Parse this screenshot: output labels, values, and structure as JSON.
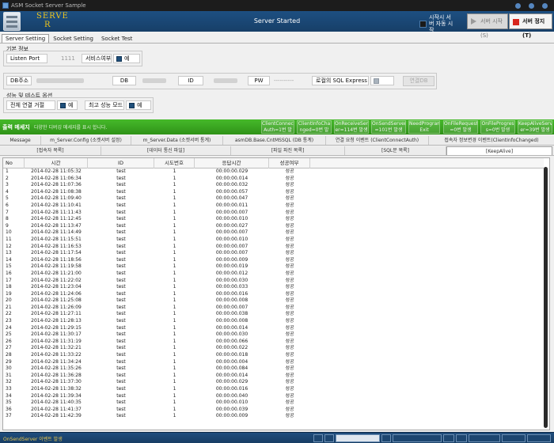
{
  "window": {
    "title": "ASM Socket Server Sample"
  },
  "header": {
    "logo_text_1": "SERVE",
    "logo_text_2": "R",
    "status": "Server Started",
    "auto_start_label": "시작시 서버 자동 시작",
    "start_button": "서버 시작(S)",
    "stop_button": "서버 정지(T)"
  },
  "tabs": [
    "Server Setting",
    "Socket Setting",
    "Socket Test"
  ],
  "basic_info": {
    "title": "기본 정보",
    "listen_port_label": "Listen Port",
    "listen_port_value": "1111",
    "service_label": "서비스여부",
    "service_value": "예"
  },
  "db": {
    "addr_label": "DB주소",
    "db_label": "DB",
    "id_label": "ID",
    "pw_label": "PW",
    "pw_value": "----------",
    "local_sql_label": "로컬의 SQL Express",
    "connect_button": "연결DB"
  },
  "perf": {
    "title": "성능 및 테스트 옵션",
    "reject_label": "전체 연결 거절",
    "reject_value": "예",
    "max_perf_label": "최고 성능 모드",
    "max_perf_value": "예"
  },
  "messages": {
    "label": "출력 메세지",
    "hint": "다양한 디버깅 메세지를 표시 합니다.",
    "events": [
      {
        "line1": "ClientConnect",
        "line2": "Auth=1번 발생"
      },
      {
        "line1": "ClientInfoCha",
        "line2": "nged=0번 발생"
      },
      {
        "line1": "OnReceiveServ",
        "line2": "er=114번 발생"
      },
      {
        "line1": "OnSendServer",
        "line2": "=101번 발생"
      },
      {
        "line1": "NeedProgram",
        "line2": "Exit"
      },
      {
        "line1": "OnFileRequest",
        "line2": "=0번 발생"
      },
      {
        "line1": "OnFileProgres",
        "line2": "s=0번 발생"
      },
      {
        "line1": "KeepAliveServ",
        "line2": "er=39번 발생"
      }
    ]
  },
  "message_tabs_row1": [
    "Message",
    "m_Server.Config (소켓서버 설정)",
    "m_Server.Data (소켓서버 통계)",
    "asmDB.Base.CntMSSQL (DB 통계)",
    "연결 요청 이벤트 (ClientConnectAuth)",
    "접속자 정보변경 이벤트(ClientInfoChanged)"
  ],
  "message_tabs_row2": [
    "[접속자 목록]",
    "[데이터 통신 파일]",
    "[파일 파진 목록]",
    "[SQL문 목록]",
    "[KeepAlive]"
  ],
  "grid": {
    "columns": [
      "No",
      "시간",
      "ID",
      "시도번호",
      "응답시간",
      "성공여부"
    ],
    "rows": [
      [
        "1",
        "2014-02-28 11:05:32",
        "test",
        "1",
        "00:00:00.029",
        "성공"
      ],
      [
        "2",
        "2014-02-28 11:06:34",
        "test",
        "1",
        "00:00:00.014",
        "성공"
      ],
      [
        "3",
        "2014-02-28 11:07:36",
        "test",
        "1",
        "00:00:00.032",
        "성공"
      ],
      [
        "4",
        "2014-02-28 11:08:38",
        "test",
        "1",
        "00:00:00.057",
        "성공"
      ],
      [
        "5",
        "2014-02-28 11:09:40",
        "test",
        "1",
        "00:00:00.047",
        "성공"
      ],
      [
        "6",
        "2014-02-28 11:10:41",
        "test",
        "1",
        "00:00:00.011",
        "성공"
      ],
      [
        "7",
        "2014-02-28 11:11:43",
        "test",
        "1",
        "00:00:00.007",
        "성공"
      ],
      [
        "8",
        "2014-02-28 11:12:45",
        "test",
        "1",
        "00:00:00.010",
        "성공"
      ],
      [
        "9",
        "2014-02-28 11:13:47",
        "test",
        "1",
        "00:00:00.027",
        "성공"
      ],
      [
        "10",
        "2014-02-28 11:14:49",
        "test",
        "1",
        "00:00:00.007",
        "성공"
      ],
      [
        "11",
        "2014-02-28 11:15:51",
        "test",
        "1",
        "00:00:00.010",
        "성공"
      ],
      [
        "12",
        "2014-02-28 11:16:53",
        "test",
        "1",
        "00:00:00.007",
        "성공"
      ],
      [
        "13",
        "2014-02-28 11:17:54",
        "test",
        "1",
        "00:00:00.007",
        "성공"
      ],
      [
        "14",
        "2014-02-28 11:18:56",
        "test",
        "1",
        "00:00:00.009",
        "성공"
      ],
      [
        "15",
        "2014-02-28 11:19:58",
        "test",
        "1",
        "00:00:00.019",
        "성공"
      ],
      [
        "16",
        "2014-02-28 11:21:00",
        "test",
        "1",
        "00:00:00.012",
        "성공"
      ],
      [
        "17",
        "2014-02-28 11:22:02",
        "test",
        "1",
        "00:00:00.030",
        "성공"
      ],
      [
        "18",
        "2014-02-28 11:23:04",
        "test",
        "1",
        "00:00:00.033",
        "성공"
      ],
      [
        "19",
        "2014-02-28 11:24:06",
        "test",
        "1",
        "00:00:00.016",
        "성공"
      ],
      [
        "20",
        "2014-02-28 11:25:08",
        "test",
        "1",
        "00:00:00.008",
        "성공"
      ],
      [
        "21",
        "2014-02-28 11:26:09",
        "test",
        "1",
        "00:00:00.007",
        "성공"
      ],
      [
        "22",
        "2014-02-28 11:27:11",
        "test",
        "1",
        "00:00:00.038",
        "성공"
      ],
      [
        "23",
        "2014-02-28 11:28:13",
        "test",
        "1",
        "00:00:00.008",
        "성공"
      ],
      [
        "24",
        "2014-02-28 11:29:15",
        "test",
        "1",
        "00:00:00.014",
        "성공"
      ],
      [
        "25",
        "2014-02-28 11:30:17",
        "test",
        "1",
        "00:00:00.030",
        "성공"
      ],
      [
        "26",
        "2014-02-28 11:31:19",
        "test",
        "1",
        "00:00:00.066",
        "성공"
      ],
      [
        "27",
        "2014-02-28 11:32:21",
        "test",
        "1",
        "00:00:00.022",
        "성공"
      ],
      [
        "28",
        "2014-02-28 11:33:22",
        "test",
        "1",
        "00:00:00.018",
        "성공"
      ],
      [
        "29",
        "2014-02-28 11:34:24",
        "test",
        "1",
        "00:00:00.004",
        "성공"
      ],
      [
        "30",
        "2014-02-28 11:35:26",
        "test",
        "1",
        "00:00:00.084",
        "성공"
      ],
      [
        "31",
        "2014-02-28 11:36:28",
        "test",
        "1",
        "00:00:00.014",
        "성공"
      ],
      [
        "32",
        "2014-02-28 11:37:30",
        "test",
        "1",
        "00:00:00.029",
        "성공"
      ],
      [
        "33",
        "2014-02-28 11:38:32",
        "test",
        "1",
        "00:00:00.016",
        "성공"
      ],
      [
        "34",
        "2014-02-28 11:39:34",
        "test",
        "1",
        "00:00:00.040",
        "성공"
      ],
      [
        "35",
        "2014-02-28 11:40:35",
        "test",
        "1",
        "00:00:00.010",
        "성공"
      ],
      [
        "36",
        "2014-02-28 11:41:37",
        "test",
        "1",
        "00:00:00.039",
        "성공"
      ],
      [
        "37",
        "2014-02-28 11:42:39",
        "test",
        "1",
        "00:00:00.009",
        "성공"
      ]
    ]
  },
  "statusbar": {
    "text": "OnSendServer 이벤트 발생"
  },
  "colors": {
    "header_blue": "#1d4f82",
    "logo_gold": "#f0c419",
    "message_green": "#3aa622",
    "stop_red": "#d7261e",
    "checkbox_blue": "#1f4f7a"
  }
}
